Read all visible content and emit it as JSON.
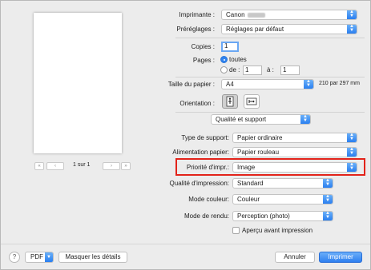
{
  "printer": {
    "label": "Imprimante :",
    "value": "Canon"
  },
  "presets": {
    "label": "Préréglages :",
    "value": "Réglages par défaut"
  },
  "copies": {
    "label": "Copies :",
    "value": "1"
  },
  "pages": {
    "label": "Pages :",
    "all_label": "toutes",
    "from_label": "de :",
    "from_value": "1",
    "to_label": "à :",
    "to_value": "1",
    "selected": "all"
  },
  "paper_size": {
    "label": "Taille du papier :",
    "value": "A4",
    "dimensions": "210 par 297 mm"
  },
  "orientation": {
    "label": "Orientation :",
    "selected": "portrait"
  },
  "section_popup": {
    "value": "Qualité et support"
  },
  "media_type": {
    "label": "Type de support:",
    "value": "Papier ordinaire"
  },
  "paper_source": {
    "label": "Alimentation papier:",
    "value": "Papier rouleau"
  },
  "print_priority": {
    "label": "Priorité d'impr.:",
    "value": "Image"
  },
  "print_quality": {
    "label": "Qualité d'impression:",
    "value": "Standard"
  },
  "color_mode": {
    "label": "Mode couleur:",
    "value": "Couleur"
  },
  "rendering_mode": {
    "label": "Mode de rendu:",
    "value": "Perception (photo)"
  },
  "preview_checkbox": {
    "label": "Aperçu avant impression",
    "checked": false
  },
  "pager": {
    "text": "1 sur 1"
  },
  "footer": {
    "help": "?",
    "pdf": "PDF",
    "hide_details": "Masquer les détails",
    "cancel": "Annuler",
    "print": "Imprimer"
  },
  "colors": {
    "accent": "#2f7ff0",
    "highlight": "#e2231a"
  }
}
